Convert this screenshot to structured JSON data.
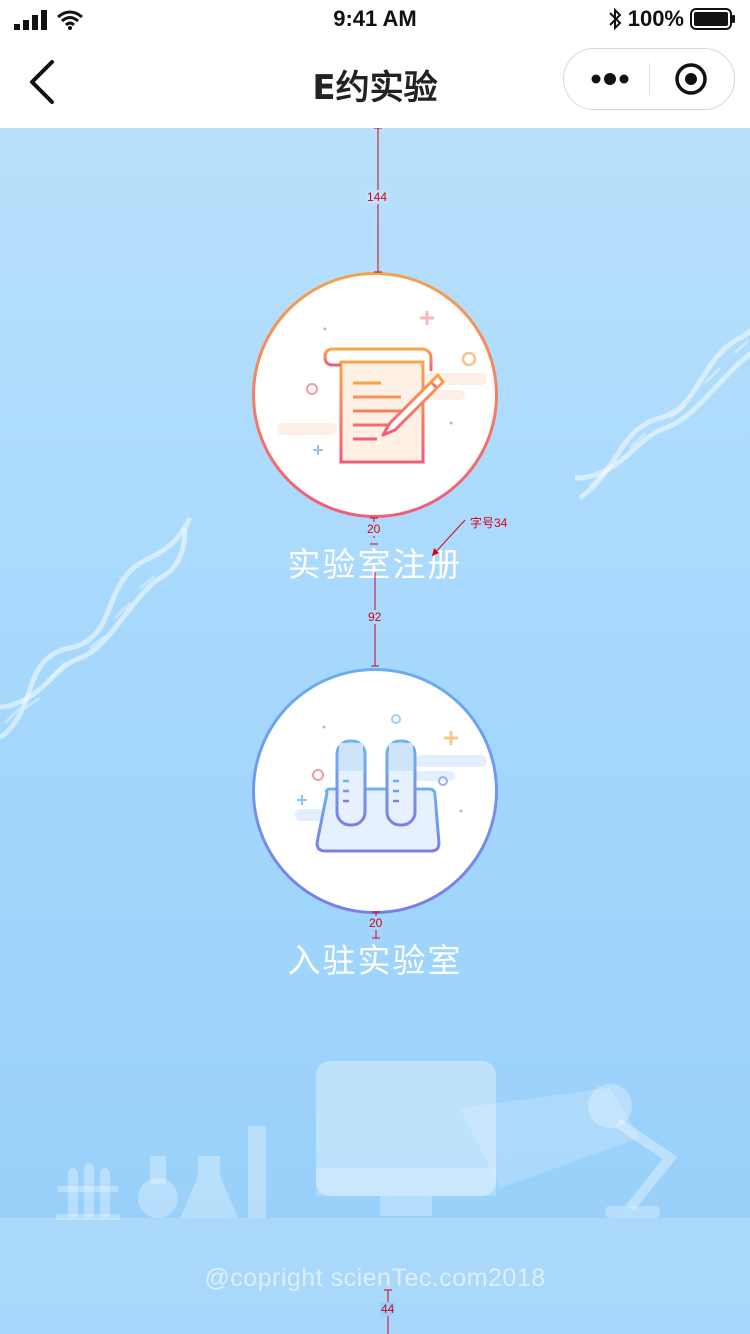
{
  "status_bar": {
    "time": "9:41 AM",
    "battery": "100%"
  },
  "nav": {
    "title": "E约实验"
  },
  "items": [
    {
      "label": "实验室注册",
      "icon": "document-edit-icon"
    },
    {
      "label": "入驻实验室",
      "icon": "test-tubes-icon"
    }
  ],
  "annotations": {
    "gap_top": "144",
    "gap_label_1": "20",
    "font_size_note": "字号34",
    "gap_between": "92",
    "gap_label_2": "20",
    "gap_bottom": "44"
  },
  "footer": {
    "copyright": "@copright scienTec.com2018"
  },
  "colors": {
    "background": "#a6d8fc",
    "card1_border": "#f6a24c",
    "card2_border": "#6aaef1",
    "annotation": "#d0021b"
  }
}
